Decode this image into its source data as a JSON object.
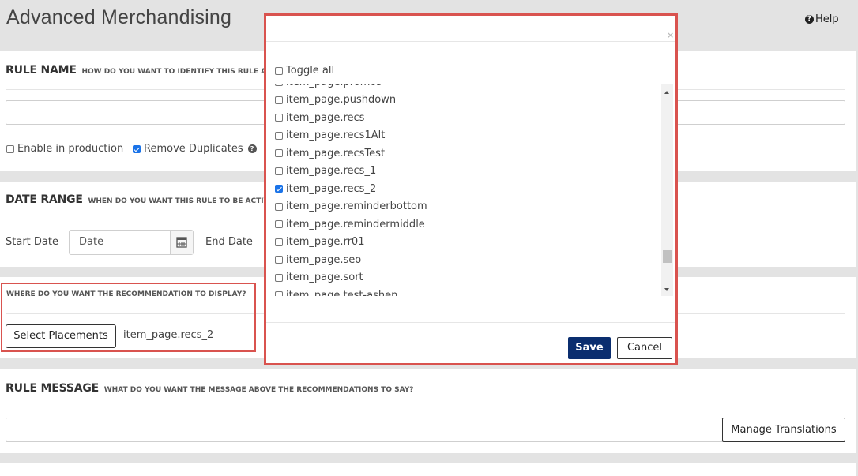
{
  "header": {
    "title": "Advanced Merchandising",
    "help_label": "Help"
  },
  "rule_name": {
    "title": "RULE NAME",
    "subtitle": "HOW DO YOU WANT TO IDENTIFY THIS RULE AN",
    "name_value": "",
    "enable_label": "Enable in production",
    "enable_checked": false,
    "remove_duplicates_label": "Remove Duplicates",
    "remove_duplicates_checked": true
  },
  "date_range": {
    "title": "DATE RANGE",
    "subtitle": "WHEN DO YOU WANT THIS RULE TO BE ACTIV",
    "start_label": "Start Date",
    "start_placeholder": "Date",
    "end_label": "End Date"
  },
  "placement": {
    "title": "WHERE DO YOU WANT THE RECOMMENDATION TO DISPLAY?",
    "button_label": "Select Placements",
    "selected": "item_page.recs_2"
  },
  "rule_message": {
    "title": "RULE MESSAGE",
    "subtitle": "WHAT DO YOU WANT THE MESSAGE ABOVE THE RECOMMENDATIONS TO SAY?",
    "message_value": "",
    "translations_button": "Manage Translations"
  },
  "modal": {
    "close_glyph": "×",
    "toggle_all_label": "Toggle all",
    "items": [
      {
        "label": "item_page.promos",
        "checked": false
      },
      {
        "label": "item_page.pushdown",
        "checked": false
      },
      {
        "label": "item_page.recs",
        "checked": false
      },
      {
        "label": "item_page.recs1Alt",
        "checked": false
      },
      {
        "label": "item_page.recsTest",
        "checked": false
      },
      {
        "label": "item_page.recs_1",
        "checked": false
      },
      {
        "label": "item_page.recs_2",
        "checked": true
      },
      {
        "label": "item_page.reminderbottom",
        "checked": false
      },
      {
        "label": "item_page.remindermiddle",
        "checked": false
      },
      {
        "label": "item_page.rr01",
        "checked": false
      },
      {
        "label": "item_page.seo",
        "checked": false
      },
      {
        "label": "item_page.sort",
        "checked": false
      },
      {
        "label": "item_page.test-ashen",
        "checked": false
      }
    ],
    "save_label": "Save",
    "cancel_label": "Cancel"
  },
  "colors": {
    "accent": "#d9534f",
    "primary": "#0b2e6f",
    "checkbox": "#1a73e8"
  },
  "icons": {
    "help": "question-circle-icon",
    "calendar": "calendar-icon",
    "close": "close-icon"
  }
}
